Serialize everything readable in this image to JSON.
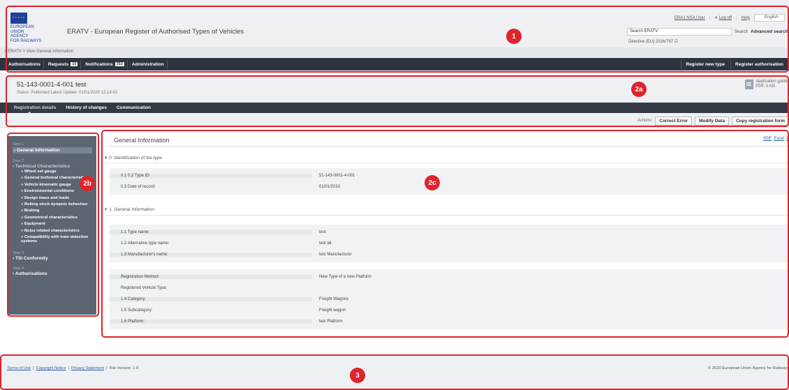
{
  "header": {
    "agency_lines": [
      "EUROPEAN",
      "UNION",
      "AGENCY",
      "FOR RAILWAYS"
    ],
    "app_title": "ERATV - European Register of Authorised Types of Vehicles",
    "user_label": "ERA1 NSA User",
    "logoff_label": "Log off",
    "help_label": "Help",
    "language": "English",
    "search_value": "Search ERATV",
    "search_button": "Search",
    "advanced_search": "Advanced search",
    "directive": "Directive (EU) 2016/797",
    "breadcrumb": "> ERATV > View General Information"
  },
  "navbar": {
    "authorisations": "Authorisations",
    "requests": "Requests",
    "requests_count": "10",
    "notifications": "Notifications",
    "notifications_count": "353",
    "administration": "Administration",
    "register_new_type": "Register new type",
    "register_authorisation": "Register authorisation"
  },
  "record": {
    "title": "51-143-0001-4-001 test",
    "status": "Status: Published   Latest Update: 01/01/2020 12:14:43",
    "app_guide_title": "Application guide",
    "app_guide_size": "PDF, 0 KB",
    "tabs": [
      "Registration details",
      "History of changes",
      "Communication"
    ],
    "actions_label": "Actions:",
    "actions": [
      "Correct Error",
      "Modify Data",
      "Copy registration form"
    ]
  },
  "sidebar": {
    "step1_label": "Step 1",
    "step1_title": "General Information",
    "step2_label": "Step 2",
    "step2_title": "Technical Characteristics",
    "step2_items": [
      "Wheel set gauge",
      "General technical characteristics",
      "Vehicle kinematic gauge",
      "Environmental conditions",
      "Design mass and loads",
      "Rolling stock dynamic behaviour",
      "Braking",
      "Geometrical characteristics",
      "Equipment",
      "Noise related characteristics",
      "Compatibility with train detection systems"
    ],
    "step3_label": "Step 3",
    "step3_title": "TSI Conformity",
    "step4_label": "Step 4",
    "step4_title": "Authorisations"
  },
  "content": {
    "title": "General Information",
    "export": [
      "PDF",
      "Excel",
      "X"
    ],
    "section0": "0. Identification of the type",
    "section0_rows": [
      {
        "label": "0.1 0.2 Type ID:",
        "value": "51-143-0001-4-001"
      },
      {
        "label": "0.3 Date of record:",
        "value": "01/01/2020"
      }
    ],
    "section1": "1. General Information",
    "section1_rows": [
      {
        "label": "1.1 Type name:",
        "value": "test"
      },
      {
        "label": "1.2 Alternative type name:",
        "value": "test alt."
      },
      {
        "label": "1.3 Manufacturer's name:",
        "value": "test Manufacturer"
      }
    ],
    "section1b_rows": [
      {
        "label": "Registration Method:",
        "value": "New Type of a new Platform"
      },
      {
        "label": "Registered Vehicle Type:",
        "value": ""
      },
      {
        "label": "1.4 Category:",
        "value": "Freight Wagons"
      },
      {
        "label": "1.5 Subcategory:",
        "value": "Freight wagon"
      },
      {
        "label": "1.6 Platform:",
        "value": "test Platform"
      }
    ]
  },
  "footer": {
    "terms": "Terms of Use",
    "copyright_notice": "Copyright Notice",
    "privacy": "Privacy Statement",
    "file_version": "File Version: 1.8",
    "copyright": "© 2020 European Union Agency for Railways"
  },
  "callouts": {
    "c1": "1",
    "c2a": "2a",
    "c2b": "2b",
    "c2c": "2c",
    "c3": "3",
    "color": "#e0232b"
  }
}
